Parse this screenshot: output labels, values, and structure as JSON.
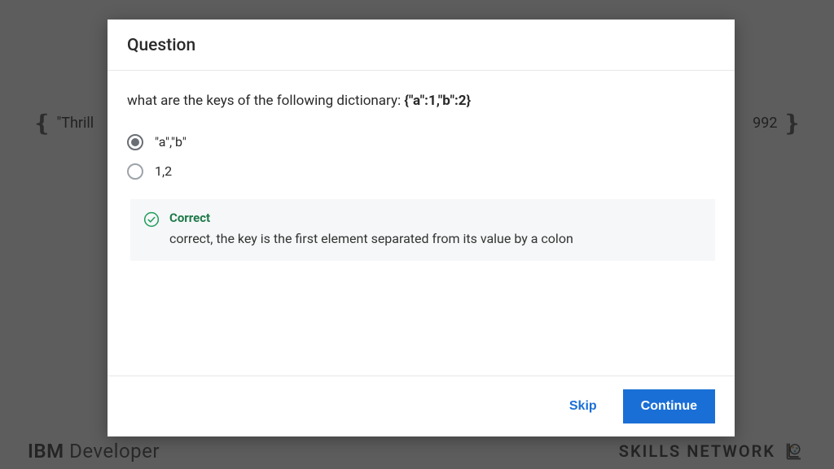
{
  "background": {
    "left_text": "\"Thrill",
    "right_text": "992",
    "footer_left_ibm": "IBM",
    "footer_left_dev": " Developer",
    "footer_right": "SKILLS NETWORK"
  },
  "modal": {
    "title": "Question",
    "question_prefix": "what are the keys of the following dictionary: ",
    "question_bold": "{\"a\":1,\"b\":2}",
    "options": [
      {
        "label": "\"a\",\"b\"",
        "selected": true
      },
      {
        "label": "1,2",
        "selected": false
      }
    ],
    "feedback": {
      "title": "Correct",
      "text": "correct, the key is the first element  separated from its value by a colon"
    },
    "skip_label": "Skip",
    "continue_label": "Continue"
  }
}
